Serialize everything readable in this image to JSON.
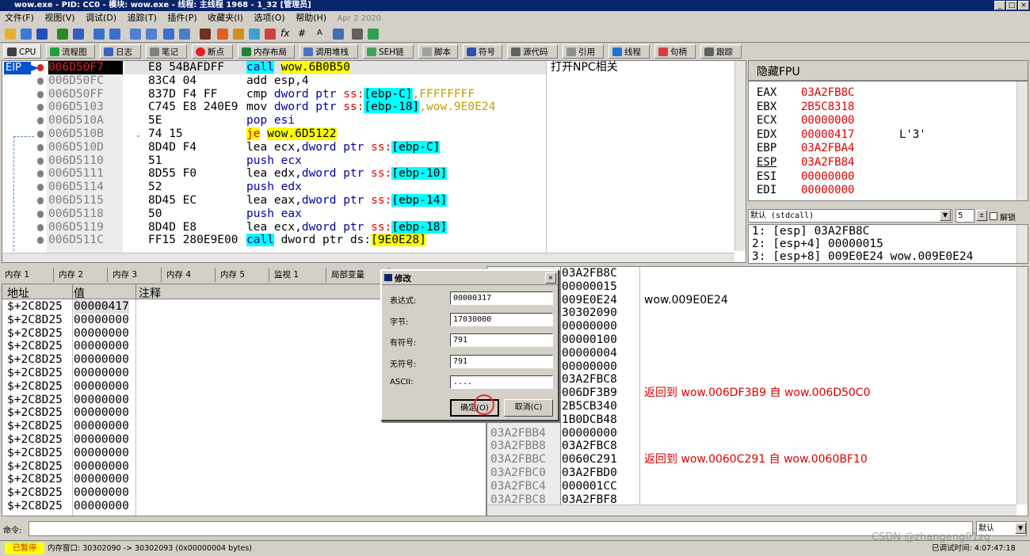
{
  "window": {
    "title": "wow.exe - PID: CC0 - 模块: wow.exe - 线程: 主线程 1968 - 1_32 [管理员]",
    "min": "_",
    "max": "□",
    "close": "×"
  },
  "menu": [
    "文件(F)",
    "视图(V)",
    "调试(D)",
    "追踪(T)",
    "插件(P)",
    "收藏夹(I)",
    "选项(O)",
    "帮助(H)",
    "Apr 2 2020"
  ],
  "tabs": [
    "CPU",
    "流程图",
    "日志",
    "笔记",
    "断点",
    "内存布局",
    "调用堆栈",
    "SEH链",
    "脚本",
    "符号",
    "源代码",
    "引用",
    "线程",
    "句柄",
    "跟踪"
  ],
  "disasm": {
    "rows": [
      {
        "addr": "006D50F7",
        "bytes": "E8 54BAFDFF",
        "parts": [
          [
            "call",
            "hl-c kw-b"
          ],
          [
            " ",
            ""
          ],
          [
            "wow.6B0B50",
            "hl-y"
          ]
        ],
        "eip": true
      },
      {
        "addr": "006D50FC",
        "bytes": "83C4 04",
        "parts": [
          [
            "add esp,4",
            ""
          ]
        ]
      },
      {
        "addr": "006D50FF",
        "bytes": "837D F4 FF",
        "parts": [
          [
            "cmp ",
            ""
          ],
          [
            "dword ptr ",
            "kw-b"
          ],
          [
            "ss:",
            "kw-r"
          ],
          [
            "[ebp-C]",
            "hl-c"
          ],
          [
            ",FFFFFFFF",
            "kw-o"
          ]
        ]
      },
      {
        "addr": "006D5103",
        "bytes": "C745 E8 240E9",
        "parts": [
          [
            "mov ",
            ""
          ],
          [
            "dword ptr ",
            "kw-b"
          ],
          [
            "ss:",
            "kw-r"
          ],
          [
            "[ebp-18]",
            "hl-c"
          ],
          [
            ",wow.9E0E24",
            "kw-o"
          ]
        ]
      },
      {
        "addr": "006D510A",
        "bytes": "5E",
        "parts": [
          [
            "pop esi",
            "kw-b"
          ]
        ]
      },
      {
        "addr": "006D510B",
        "bytes": "74 15",
        "parts": [
          [
            "je",
            "hl-y kw-r"
          ],
          [
            " ",
            ""
          ],
          [
            "wow.6D5122",
            "hl-y"
          ]
        ]
      },
      {
        "addr": "006D510D",
        "bytes": "8D4D F4",
        "parts": [
          [
            "lea ecx,",
            ""
          ],
          [
            "dword ptr ",
            "kw-b"
          ],
          [
            "ss:",
            "kw-r"
          ],
          [
            "[ebp-C]",
            "hl-c"
          ]
        ]
      },
      {
        "addr": "006D5110",
        "bytes": "51",
        "parts": [
          [
            "push ecx",
            "kw-b"
          ]
        ]
      },
      {
        "addr": "006D5111",
        "bytes": "8D55 F0",
        "parts": [
          [
            "lea edx,",
            ""
          ],
          [
            "dword ptr ",
            "kw-b"
          ],
          [
            "ss:",
            "kw-r"
          ],
          [
            "[ebp-10]",
            "hl-c"
          ]
        ]
      },
      {
        "addr": "006D5114",
        "bytes": "52",
        "parts": [
          [
            "push edx",
            "kw-b"
          ]
        ]
      },
      {
        "addr": "006D5115",
        "bytes": "8D45 EC",
        "parts": [
          [
            "lea eax,",
            ""
          ],
          [
            "dword ptr ",
            "kw-b"
          ],
          [
            "ss:",
            "kw-r"
          ],
          [
            "[ebp-14]",
            "hl-c"
          ]
        ]
      },
      {
        "addr": "006D5118",
        "bytes": "50",
        "parts": [
          [
            "push eax",
            "kw-b"
          ]
        ]
      },
      {
        "addr": "006D5119",
        "bytes": "8D4D E8",
        "parts": [
          [
            "lea ecx,",
            ""
          ],
          [
            "dword ptr ",
            "kw-b"
          ],
          [
            "ss:",
            "kw-r"
          ],
          [
            "[ebp-18]",
            "hl-c"
          ]
        ]
      },
      {
        "addr": "006D511C",
        "bytes": "FF15 280E9E00",
        "parts": [
          [
            "call",
            "hl-c kw-b"
          ],
          [
            " dword ptr ds:",
            ""
          ],
          [
            "[9E0E28]",
            "hl-y"
          ]
        ]
      }
    ],
    "eip_label": "EIP",
    "comment": "打开NPC相关"
  },
  "registers": {
    "header": "隐藏FPU",
    "items": [
      {
        "name": "EAX",
        "value": "03A2FB8C",
        "extra": ""
      },
      {
        "name": "EBX",
        "value": "2B5C8318",
        "extra": ""
      },
      {
        "name": "ECX",
        "value": "00000000",
        "extra": ""
      },
      {
        "name": "EDX",
        "value": "00000417",
        "extra": "L'3'"
      },
      {
        "name": "EBP",
        "value": "03A2FBA4",
        "extra": ""
      },
      {
        "name": "ESP",
        "value": "03A2FB84",
        "extra": ""
      },
      {
        "name": "ESI",
        "value": "00000000",
        "extra": ""
      },
      {
        "name": "EDI",
        "value": "00000000",
        "extra": ""
      }
    ],
    "callconv": "默认 (stdcall)",
    "argcount": "5",
    "unlock": "解锁",
    "args": [
      "1: [esp] 03A2FB8C",
      "2: [esp+4] 00000015",
      "3: [esp+8] 009E0E24 wow.009E0E24"
    ]
  },
  "bottom_tabs": [
    "内存 1",
    "内存 2",
    "内存 3",
    "内存 4",
    "内存 5",
    "监视 1",
    "局部变量"
  ],
  "watch": {
    "headers": [
      "地址",
      "值",
      "注释"
    ],
    "addr_prefix": "$+2C8D25",
    "values": [
      "00000417",
      "00000000",
      "00000000",
      "00000000",
      "00000000",
      "00000000",
      "00000000",
      "00000000",
      "00000000",
      "00000000",
      "00000000",
      "00000000",
      "00000000",
      "00000000",
      "00000000",
      "00000000"
    ]
  },
  "dialog": {
    "title": "修改",
    "fields": [
      {
        "label": "表达式:",
        "value": "00000317"
      },
      {
        "label": "字节:",
        "value": "17030000"
      },
      {
        "label": "有符号:",
        "value": "791"
      },
      {
        "label": "无符号:",
        "value": "791"
      },
      {
        "label": "ASCII:",
        "value": "...."
      }
    ],
    "ok": "确定(O)",
    "cancel": "取消(C)"
  },
  "stack": {
    "rows": [
      {
        "addr": "",
        "value": "03A2FB8C",
        "comment": ""
      },
      {
        "addr": "",
        "value": "00000015",
        "comment": ""
      },
      {
        "addr": "",
        "value": "009E0E24",
        "comment": "wow.009E0E24"
      },
      {
        "addr": "",
        "value": "30302090",
        "comment": ""
      },
      {
        "addr": "",
        "value": "00000000",
        "comment": ""
      },
      {
        "addr": "",
        "value": "00000100",
        "comment": ""
      },
      {
        "addr": "",
        "value": "00000004",
        "comment": ""
      },
      {
        "addr": "",
        "value": "00000000",
        "comment": ""
      },
      {
        "addr": "",
        "value": "03A2FBC8",
        "comment": ""
      },
      {
        "addr": "",
        "value": "006DF3B9",
        "comment": "返回到 wow.006DF3B9 自 wow.006D50C0"
      },
      {
        "addr": "",
        "value": "2B5CB340",
        "comment": ""
      },
      {
        "addr": "",
        "value": "1B0DCB48",
        "comment": ""
      },
      {
        "addr": "03A2FBB4",
        "value": "00000000",
        "comment": ""
      },
      {
        "addr": "03A2FBB8",
        "value": "03A2FBC8",
        "comment": ""
      },
      {
        "addr": "03A2FBBC",
        "value": "0060C291",
        "comment": "返回到 wow.0060C291 自 wow.0060BF10"
      },
      {
        "addr": "03A2FBC0",
        "value": "03A2FBD0",
        "comment": ""
      },
      {
        "addr": "03A2FBC4",
        "value": "000001CC",
        "comment": ""
      },
      {
        "addr": "03A2FBC8",
        "value": "03A2FBF8",
        "comment": ""
      }
    ]
  },
  "command": {
    "label": "命令:",
    "dropdown": "默认"
  },
  "status": {
    "state": "已暂停",
    "message": "内存窗口: 30302090 -> 30302093 (0x00000004 bytes)",
    "right": "已调试时间: 4:07:47:18",
    "watermark": "CSDN @zhangeng01zq"
  },
  "colors": {
    "title": "#0a246a",
    "paused": "#ffff00",
    "red": "#e00000",
    "blue": "#0000a0"
  }
}
